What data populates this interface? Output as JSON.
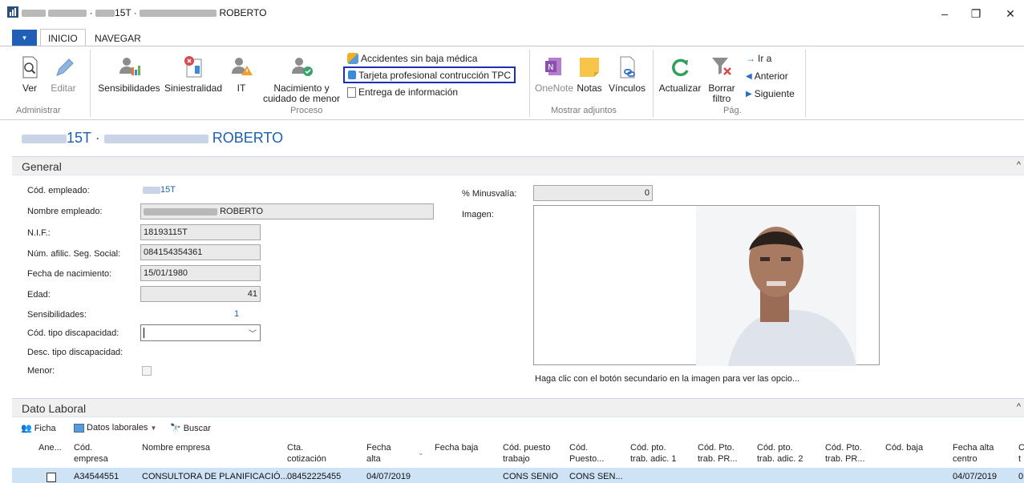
{
  "window": {
    "title_suffix": "15T ·",
    "title_name": "ROBERTO",
    "minimize": "–",
    "restore": "❐",
    "close": "✕"
  },
  "ribbon_tabs": {
    "file": "▾",
    "inicio": "INICIO",
    "navegar": "NAVEGAR"
  },
  "ribbon": {
    "ver": "Ver",
    "editar": "Editar",
    "administrar": "Administrar",
    "sensibilidades": "Sensibilidades",
    "siniestralidad": "Siniestralidad",
    "it": "IT",
    "nacimiento_line1": "Nacimiento y",
    "nacimiento_line2": "cuidado de menor",
    "accidentes": "Accidentes sin baja médica",
    "tarjeta": "Tarjeta profesional contrucción TPC",
    "entrega": "Entrega de información",
    "proceso": "Proceso",
    "onenote": "OneNote",
    "notas": "Notas",
    "vinculos": "Vínculos",
    "mostrar_adjuntos": "Mostrar adjuntos",
    "actualizar": "Actualizar",
    "borrar_line1": "Borrar",
    "borrar_line2": "filtro",
    "ira": "Ir a",
    "anterior": "Anterior",
    "siguiente": "Siguiente",
    "pag": "Pág."
  },
  "page_title": {
    "code_suffix": "15T ·",
    "name": "ROBERTO"
  },
  "general": {
    "header": "General",
    "cod_empleado_label": "Cód. empleado:",
    "cod_empleado_suffix": "15T",
    "nombre_label": "Nombre empleado:",
    "nombre_suffix": "ROBERTO",
    "nif_label": "N.I.F.:",
    "nif": "18193115T",
    "afil_label": "Núm. afilic. Seg. Social:",
    "afil": "084154354361",
    "fecha_nac_label": "Fecha de nacimiento:",
    "fecha_nac": "15/01/1980",
    "edad_label": "Edad:",
    "edad": "41",
    "sens_label": "Sensibilidades:",
    "sens": "1",
    "tipo_disc_label": "Cód. tipo discapacidad:",
    "desc_disc_label": "Desc. tipo discapacidad:",
    "menor_label": "Menor:",
    "minusvalia_label": "% Minusvalía:",
    "minusvalia": "0",
    "imagen_label": "Imagen:",
    "imagen_hint": "Haga clic con el botón secundario en la imagen para ver las opcio..."
  },
  "dato_laboral": {
    "header": "Dato Laboral",
    "ficha": "Ficha",
    "datos_laborales": "Datos laborales",
    "buscar": "Buscar",
    "columns": {
      "ane": "Ane...",
      "cod_empresa": [
        "Cód.",
        "empresa"
      ],
      "nombre_empresa": "Nombre empresa",
      "cta": [
        "Cta.",
        "cotización"
      ],
      "fecha_alta": [
        "Fecha",
        "alta"
      ],
      "fecha_baja": "Fecha baja",
      "cod_puesto": [
        "Cód. puesto",
        "trabajo"
      ],
      "cod_puesto2": [
        "Cód.",
        "Puesto..."
      ],
      "pto_adic1": [
        "Cód. pto.",
        "trab. adic. 1"
      ],
      "pto_pr1": [
        "Cód. Pto.",
        "trab. PR..."
      ],
      "pto_adic2": [
        "Cód. pto.",
        "trab. adic. 2"
      ],
      "pto_pr2": [
        "Cód. Pto.",
        "trab. PR..."
      ],
      "cod_baja": "Cód. baja",
      "fecha_alta_centro": [
        "Fecha alta",
        "centro"
      ]
    },
    "row": {
      "cod_empresa": "A34544551",
      "nombre_empresa": "CONSULTORA DE PLANIFICACIÓ...",
      "cta": "08452225455",
      "fecha_alta": "04/07/2019",
      "cod_puesto": "CONS SENIO",
      "cod_puesto2": "CONS SEN...",
      "fecha_alta_centro": "04/07/2019",
      "trailing": "0"
    }
  }
}
